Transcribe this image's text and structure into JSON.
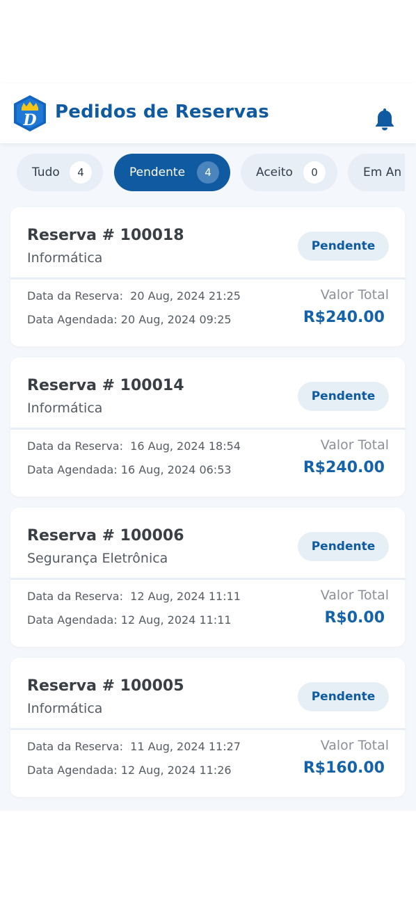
{
  "header": {
    "title": "Pedidos de Reservas",
    "logo_icon": "crown-shield-logo",
    "notification_icon": "bell-icon"
  },
  "tabs": [
    {
      "label": "Tudo",
      "count": "4",
      "active": false
    },
    {
      "label": "Pendente",
      "count": "4",
      "active": true
    },
    {
      "label": "Aceito",
      "count": "0",
      "active": false
    },
    {
      "label": "Em An",
      "count": "",
      "active": false
    }
  ],
  "labels": {
    "booking_date": "Data da Reserva:  ",
    "scheduled_date": "Data Agendada: ",
    "total": "Valor Total"
  },
  "reservations": [
    {
      "title": "Reserva # 100018",
      "category": "Informática",
      "status": "Pendente",
      "booking_date": "20 Aug, 2024 21:25",
      "scheduled_date": "20 Aug, 2024 09:25",
      "total": "R$240.00"
    },
    {
      "title": "Reserva # 100014",
      "category": "Informática",
      "status": "Pendente",
      "booking_date": "16 Aug, 2024 18:54",
      "scheduled_date": "16 Aug, 2024 06:53",
      "total": "R$240.00"
    },
    {
      "title": "Reserva # 100006",
      "category": "Segurança Eletrônica",
      "status": "Pendente",
      "booking_date": "12 Aug, 2024 11:11",
      "scheduled_date": "12 Aug, 2024 11:11",
      "total": "R$0.00"
    },
    {
      "title": "Reserva # 100005",
      "category": "Informática",
      "status": "Pendente",
      "booking_date": "11 Aug, 2024 11:27",
      "scheduled_date": "12 Aug, 2024 11:26",
      "total": "R$160.00"
    }
  ],
  "colors": {
    "primary": "#0f5aa0",
    "tab_bg": "#e8eef5",
    "background": "#f4f7fb"
  }
}
